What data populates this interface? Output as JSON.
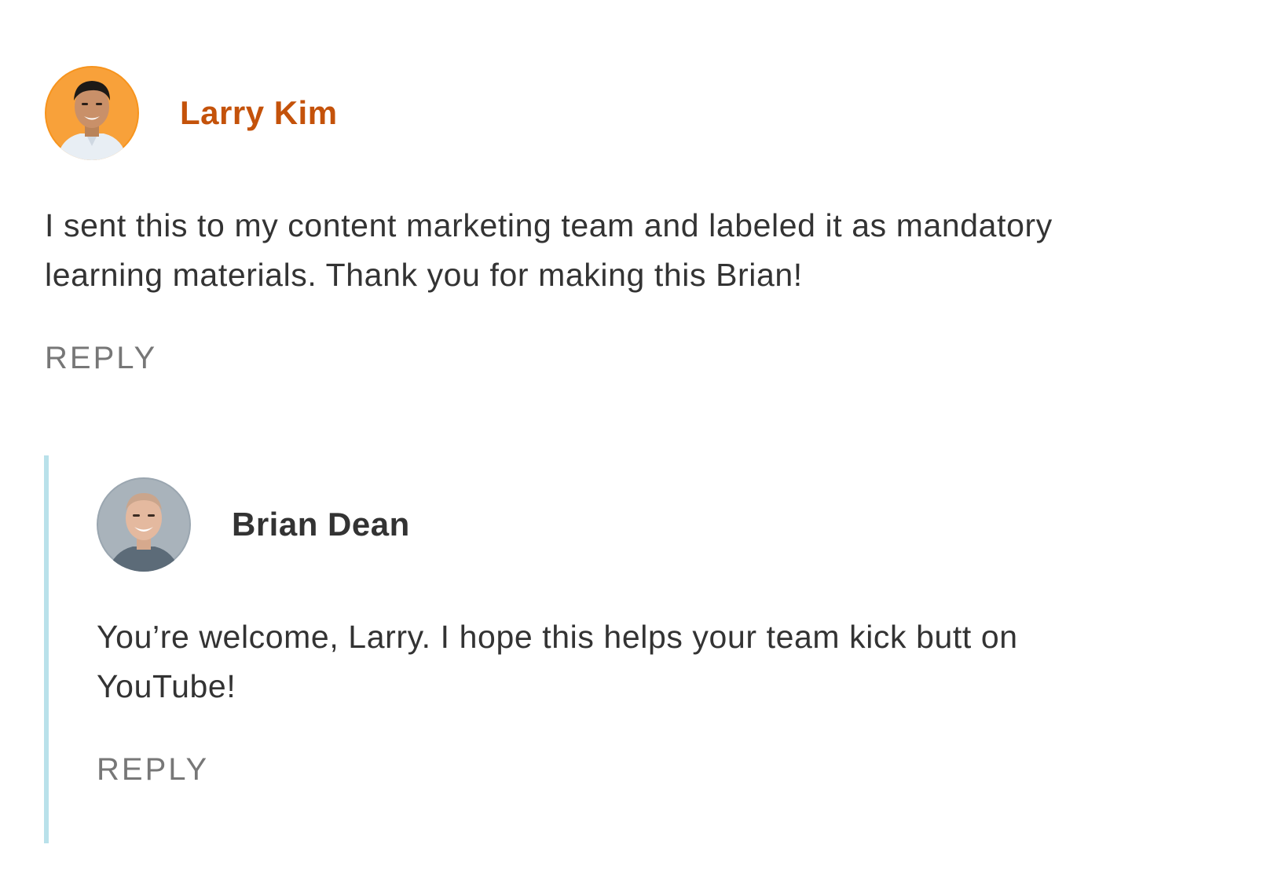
{
  "colors": {
    "author_highlight": "#c4520a",
    "author_default": "#333333",
    "body_text": "#333333",
    "reply_text": "#777777",
    "thread_line": "#b9e1ea",
    "larry_avatar_bg": "#f7941d"
  },
  "comments": [
    {
      "author": "Larry Kim",
      "avatar_icon": "larry-kim-avatar",
      "body": "I sent this to my content marketing team and labeled it as mandatory learning materials. Thank you for making this Brian!",
      "reply_label": "REPLY",
      "replies": [
        {
          "author": "Brian Dean",
          "avatar_icon": "brian-dean-avatar",
          "body": "You’re welcome, Larry. I hope this helps your team kick butt on YouTube!",
          "reply_label": "REPLY"
        }
      ]
    }
  ]
}
